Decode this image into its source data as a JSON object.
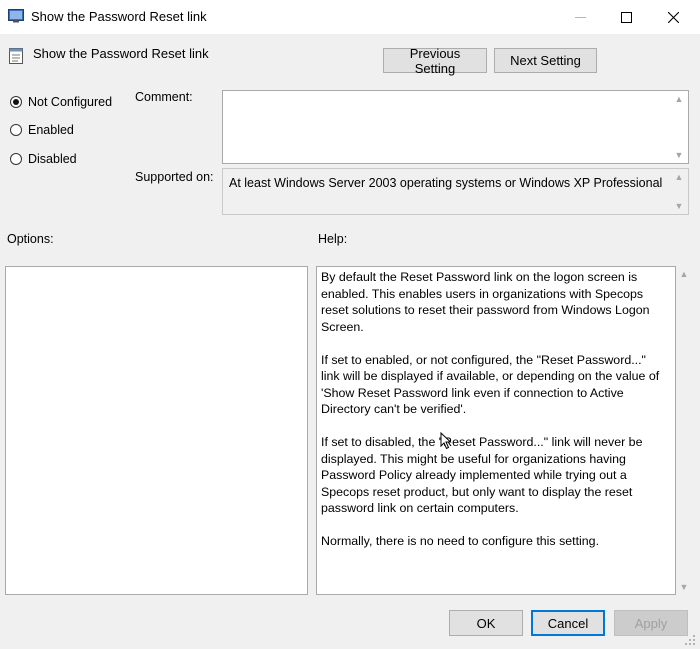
{
  "window": {
    "title": "Show the Password Reset link",
    "minimize_icon": "minimize-icon",
    "maximize_icon": "maximize-icon",
    "close_icon": "close-icon"
  },
  "header": {
    "setting_name": "Show the Password Reset link",
    "previous_label": "Previous Setting",
    "next_label": "Next Setting"
  },
  "state": {
    "options": [
      {
        "label": "Not Configured",
        "checked": true
      },
      {
        "label": "Enabled",
        "checked": false
      },
      {
        "label": "Disabled",
        "checked": false
      }
    ]
  },
  "comment": {
    "label": "Comment:",
    "value": ""
  },
  "supported": {
    "label": "Supported on:",
    "value": "At least Windows Server 2003 operating systems or Windows XP Professional"
  },
  "options_panel": {
    "label": "Options:"
  },
  "help": {
    "label": "Help:",
    "paragraphs": [
      "By default the Reset Password link on the logon screen is enabled. This enables users in organizations with Specops reset solutions to reset their password from Windows Logon Screen.",
      "If set to enabled, or not configured, the \"Reset Password...\" link will be displayed if available, or depending on the value of 'Show Reset Password link even if connection to Active Directory can't be verified'.",
      "If set to disabled, the \"Reset Password...\" link will never be displayed. This might be useful for organizations having Password Policy already implemented while trying out a Specops reset product, but only want to display the reset password link on certain computers.",
      "Normally, there is no need to configure this setting."
    ]
  },
  "footer": {
    "ok_label": "OK",
    "cancel_label": "Cancel",
    "apply_label": "Apply"
  },
  "colors": {
    "window_bg": "#f0f0f0",
    "titlebar_bg": "#ffffff",
    "focus_border": "#0078d7"
  }
}
